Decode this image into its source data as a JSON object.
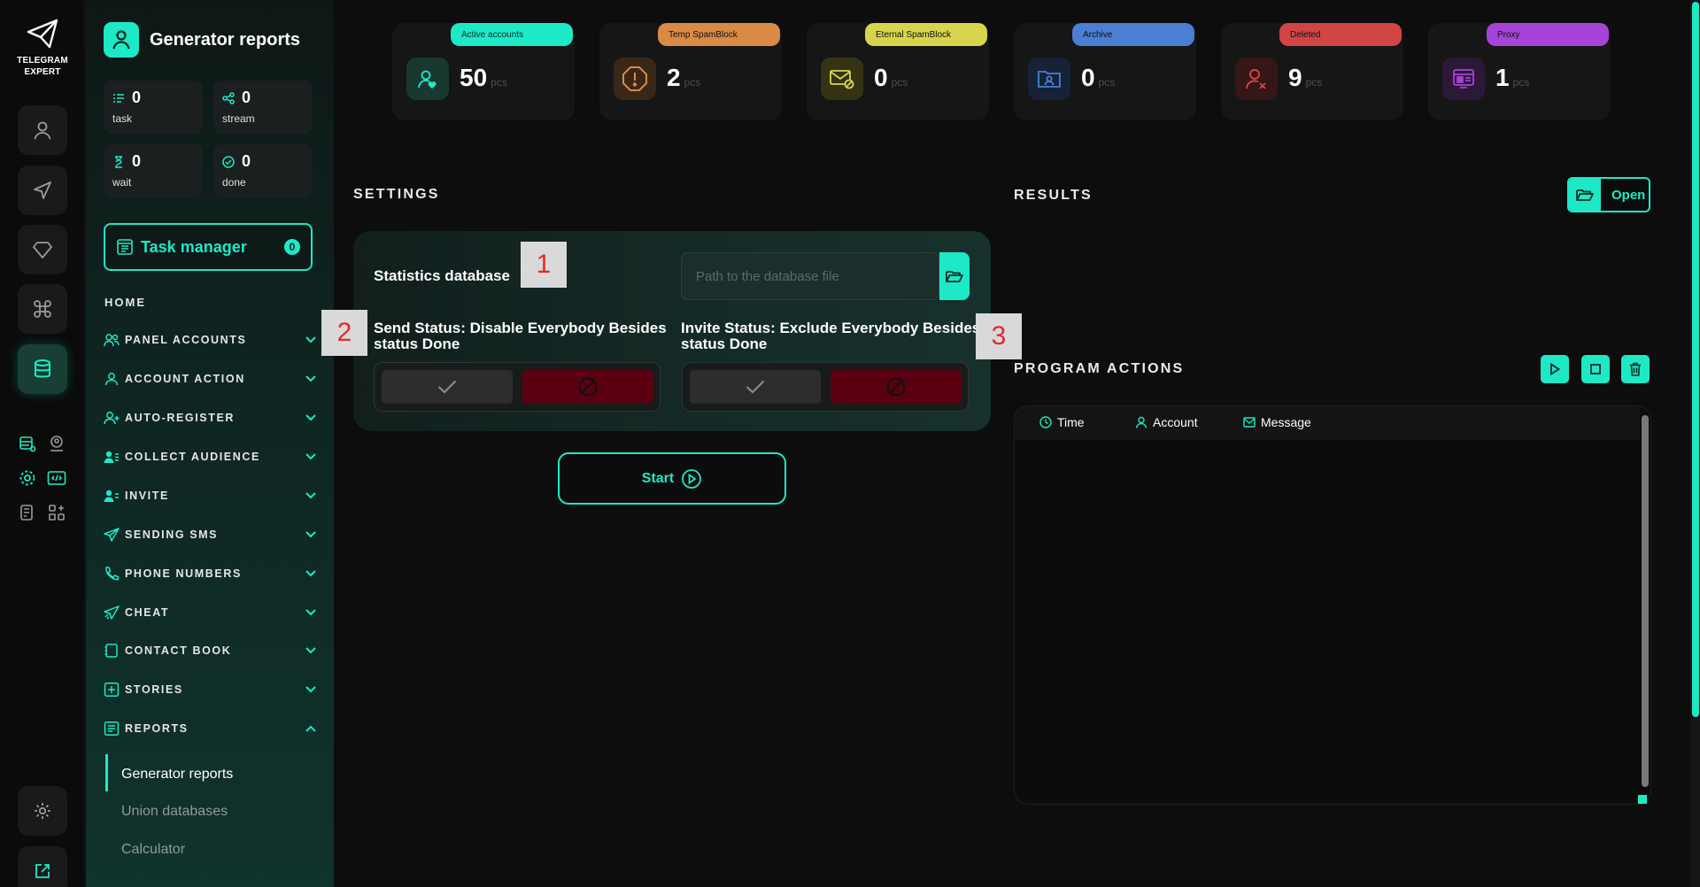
{
  "app": {
    "logo_line1": "TELEGRAM",
    "logo_line2": "EXPERT"
  },
  "sidebar": {
    "title": "Generator reports",
    "stats": [
      {
        "icon": "list-icon",
        "value": "0",
        "label": "task"
      },
      {
        "icon": "share-icon",
        "value": "0",
        "label": "stream"
      },
      {
        "icon": "hourglass-icon",
        "value": "0",
        "label": "wait"
      },
      {
        "icon": "check-circle-icon",
        "value": "0",
        "label": "done"
      }
    ],
    "task_manager": {
      "label": "Task manager",
      "count": "0"
    },
    "home_label": "HOME",
    "nav": [
      {
        "label": "PANEL ACCOUNTS",
        "icon": "users-icon",
        "expanded": false
      },
      {
        "label": "ACCOUNT ACTION",
        "icon": "user-icon",
        "expanded": false
      },
      {
        "label": "AUTO-REGISTER",
        "icon": "user-plus-icon",
        "expanded": false
      },
      {
        "label": "COLLECT AUDIENCE",
        "icon": "audience-icon",
        "expanded": false
      },
      {
        "label": "INVITE",
        "icon": "invite-icon",
        "expanded": false
      },
      {
        "label": "SENDING SMS",
        "icon": "send-icon",
        "expanded": false
      },
      {
        "label": "PHONE NUMBERS",
        "icon": "phone-icon",
        "expanded": false
      },
      {
        "label": "CHEAT",
        "icon": "cheat-icon",
        "expanded": false
      },
      {
        "label": "CONTACT BOOK",
        "icon": "book-icon",
        "expanded": false
      },
      {
        "label": "STORIES",
        "icon": "plus-square-icon",
        "expanded": false
      },
      {
        "label": "REPORTS",
        "icon": "report-icon",
        "expanded": true
      }
    ],
    "reports_sub": [
      {
        "label": "Generator reports",
        "active": true
      },
      {
        "label": "Union databases",
        "active": false
      },
      {
        "label": "Calculator",
        "active": false
      }
    ]
  },
  "cards": [
    {
      "tag": "Active accounts",
      "value": "50",
      "unit": "pcs",
      "color": "#1de9c6",
      "icon_bg": "#183830",
      "icon": "user-heart-icon"
    },
    {
      "tag": "Temp SpamBlock",
      "value": "2",
      "unit": "pcs",
      "color": "#d98a45",
      "icon_bg": "#3a2718",
      "icon": "alert-octagon-icon"
    },
    {
      "tag": "Eternal SpamBlock",
      "value": "0",
      "unit": "pcs",
      "color": "#d8d44c",
      "icon_bg": "#343315",
      "icon": "mail-blocked-icon"
    },
    {
      "tag": "Archive",
      "value": "0",
      "unit": "pcs",
      "color": "#4a7fd4",
      "icon_bg": "#172238",
      "icon": "folder-user-icon"
    },
    {
      "tag": "Deleted",
      "value": "9",
      "unit": "pcs",
      "color": "#d24545",
      "icon_bg": "#361616",
      "icon": "user-x-icon"
    },
    {
      "tag": "Proxy",
      "value": "1",
      "unit": "pcs",
      "color": "#a643d8",
      "icon_bg": "#2c1838",
      "icon": "proxy-icon"
    }
  ],
  "settings": {
    "title": "SETTINGS",
    "db_label": "Statistics database",
    "db_placeholder": "Path to the database file",
    "db_value": "",
    "send_status_line1": "Send Status: Disable Everybody Besides",
    "send_status_line2": "status Done",
    "invite_status_line1": "Invite Status: Exclude Everybody Besides",
    "invite_status_line2": "status Done",
    "start_label": "Start"
  },
  "markers": [
    "1",
    "2",
    "3"
  ],
  "results": {
    "title": "RESULTS",
    "open_label": "Open"
  },
  "actions": {
    "title": "PROGRAM ACTIONS",
    "columns": [
      {
        "label": "Time",
        "icon": "clock-icon"
      },
      {
        "label": "Account",
        "icon": "user-icon"
      },
      {
        "label": "Message",
        "icon": "mail-icon"
      }
    ]
  },
  "colors": {
    "accent": "#1de9c6",
    "danger": "#5b0010"
  }
}
